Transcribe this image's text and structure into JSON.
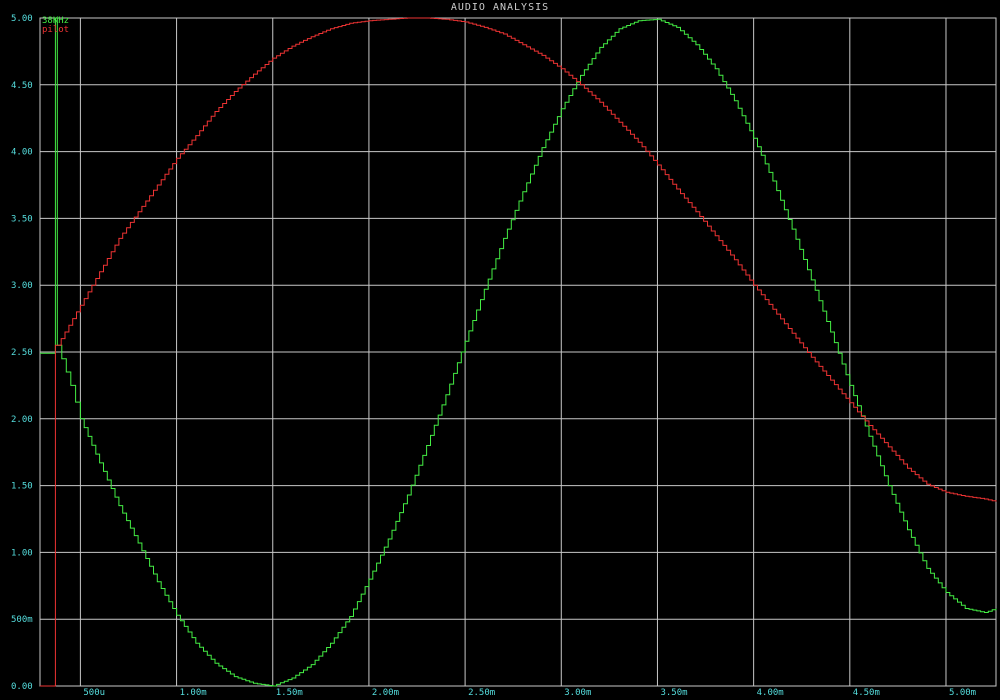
{
  "chart_data": {
    "type": "line",
    "title": "AUDIO ANALYSIS",
    "xlabel": "",
    "ylabel": "",
    "xlim": [
      0.00029,
      0.00526
    ],
    "ylim": [
      0,
      5.0
    ],
    "grid": true,
    "legend_position": "top-left",
    "y_ticks": [
      {
        "value": 0,
        "label": "0.00"
      },
      {
        "value": 0.5,
        "label": "500m"
      },
      {
        "value": 1.0,
        "label": "1.00"
      },
      {
        "value": 1.5,
        "label": "1.50"
      },
      {
        "value": 2.0,
        "label": "2.00"
      },
      {
        "value": 2.5,
        "label": "2.50"
      },
      {
        "value": 3.0,
        "label": "3.00"
      },
      {
        "value": 3.5,
        "label": "3.50"
      },
      {
        "value": 4.0,
        "label": "4.00"
      },
      {
        "value": 4.5,
        "label": "4.50"
      },
      {
        "value": 5.0,
        "label": "5.00"
      }
    ],
    "x_ticks": [
      {
        "value": 0.0005,
        "label": "500u"
      },
      {
        "value": 0.001,
        "label": "1.00m"
      },
      {
        "value": 0.0015,
        "label": "1.50m"
      },
      {
        "value": 0.002,
        "label": "2.00m"
      },
      {
        "value": 0.0025,
        "label": "2.50m"
      },
      {
        "value": 0.003,
        "label": "3.00m"
      },
      {
        "value": 0.0035,
        "label": "3.50m"
      },
      {
        "value": 0.004,
        "label": "4.00m"
      },
      {
        "value": 0.0045,
        "label": "4.50m"
      },
      {
        "value": 0.005,
        "label": "5.00m"
      }
    ],
    "series": [
      {
        "name": "38KHz",
        "color": "#44ee44",
        "points": [
          [
            0.00029,
            2.49
          ],
          [
            0.00037,
            2.49
          ],
          [
            0.00037,
            5.0
          ],
          [
            0.00038,
            5.0
          ],
          [
            0.00038,
            2.55
          ],
          [
            0.00045,
            2.25
          ],
          [
            0.0005,
            2.0
          ],
          [
            0.0006,
            1.67
          ],
          [
            0.0007,
            1.35
          ],
          [
            0.0008,
            1.07
          ],
          [
            0.0009,
            0.78
          ],
          [
            0.001,
            0.53
          ],
          [
            0.0011,
            0.32
          ],
          [
            0.0012,
            0.17
          ],
          [
            0.0013,
            0.07
          ],
          [
            0.0014,
            0.02
          ],
          [
            0.0015,
            0.0
          ],
          [
            0.0016,
            0.06
          ],
          [
            0.0017,
            0.16
          ],
          [
            0.0018,
            0.32
          ],
          [
            0.0019,
            0.52
          ],
          [
            0.002,
            0.8
          ],
          [
            0.0021,
            1.1
          ],
          [
            0.0022,
            1.43
          ],
          [
            0.0023,
            1.8
          ],
          [
            0.0024,
            2.18
          ],
          [
            0.0025,
            2.58
          ],
          [
            0.0026,
            2.97
          ],
          [
            0.0027,
            3.35
          ],
          [
            0.0028,
            3.7
          ],
          [
            0.0029,
            4.03
          ],
          [
            0.003,
            4.32
          ],
          [
            0.0031,
            4.57
          ],
          [
            0.0032,
            4.78
          ],
          [
            0.0033,
            4.92
          ],
          [
            0.0034,
            4.98
          ],
          [
            0.0035,
            4.99
          ],
          [
            0.0036,
            4.93
          ],
          [
            0.0037,
            4.8
          ],
          [
            0.0038,
            4.62
          ],
          [
            0.0039,
            4.38
          ],
          [
            0.004,
            4.1
          ],
          [
            0.0041,
            3.78
          ],
          [
            0.0042,
            3.42
          ],
          [
            0.0043,
            3.04
          ],
          [
            0.0044,
            2.65
          ],
          [
            0.0045,
            2.25
          ],
          [
            0.0046,
            1.87
          ],
          [
            0.0047,
            1.5
          ],
          [
            0.0048,
            1.17
          ],
          [
            0.0049,
            0.88
          ],
          [
            0.005,
            0.7
          ],
          [
            0.0051,
            0.58
          ],
          [
            0.0052,
            0.55
          ],
          [
            0.00526,
            0.58
          ]
        ]
      },
      {
        "name": "pilot",
        "color": "#ee3333",
        "points": [
          [
            0.00029,
            0.0
          ],
          [
            0.00037,
            0.0
          ],
          [
            0.00037,
            2.55
          ],
          [
            0.0004,
            2.6
          ],
          [
            0.0005,
            2.85
          ],
          [
            0.0006,
            3.1
          ],
          [
            0.0007,
            3.35
          ],
          [
            0.0008,
            3.55
          ],
          [
            0.0009,
            3.75
          ],
          [
            0.001,
            3.95
          ],
          [
            0.0011,
            4.12
          ],
          [
            0.0012,
            4.3
          ],
          [
            0.0013,
            4.45
          ],
          [
            0.0014,
            4.58
          ],
          [
            0.0015,
            4.7
          ],
          [
            0.0016,
            4.79
          ],
          [
            0.0017,
            4.86
          ],
          [
            0.0018,
            4.92
          ],
          [
            0.0019,
            4.96
          ],
          [
            0.002,
            4.98
          ],
          [
            0.0021,
            4.99
          ],
          [
            0.0022,
            5.0
          ],
          [
            0.0023,
            5.0
          ],
          [
            0.0024,
            4.99
          ],
          [
            0.0025,
            4.97
          ],
          [
            0.0026,
            4.93
          ],
          [
            0.0027,
            4.88
          ],
          [
            0.0028,
            4.8
          ],
          [
            0.0029,
            4.72
          ],
          [
            0.003,
            4.62
          ],
          [
            0.0031,
            4.5
          ],
          [
            0.0032,
            4.37
          ],
          [
            0.0033,
            4.22
          ],
          [
            0.0034,
            4.07
          ],
          [
            0.0035,
            3.9
          ],
          [
            0.0036,
            3.72
          ],
          [
            0.0037,
            3.55
          ],
          [
            0.0038,
            3.37
          ],
          [
            0.0039,
            3.19
          ],
          [
            0.004,
            3.0
          ],
          [
            0.0041,
            2.82
          ],
          [
            0.0042,
            2.64
          ],
          [
            0.0043,
            2.46
          ],
          [
            0.0044,
            2.29
          ],
          [
            0.0045,
            2.12
          ],
          [
            0.0046,
            1.95
          ],
          [
            0.0047,
            1.79
          ],
          [
            0.0048,
            1.63
          ],
          [
            0.0049,
            1.51
          ],
          [
            0.005,
            1.45
          ],
          [
            0.0051,
            1.42
          ],
          [
            0.0052,
            1.4
          ],
          [
            0.00526,
            1.38
          ]
        ]
      }
    ]
  }
}
